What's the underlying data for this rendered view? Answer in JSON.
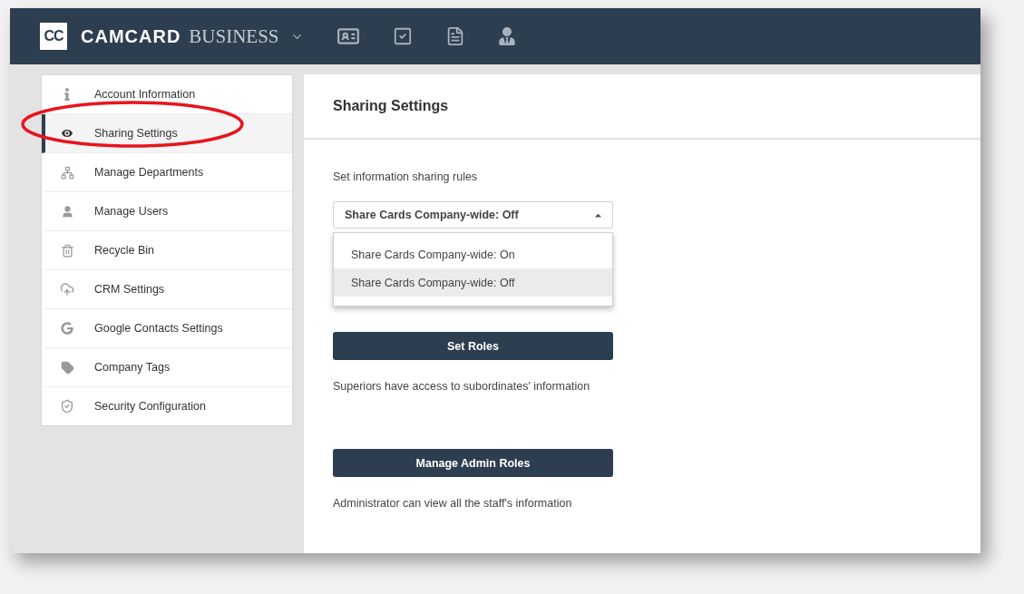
{
  "header": {
    "logo": "CC",
    "brand": "CAMCARD",
    "product": "BUSINESS"
  },
  "sidebar": {
    "items": [
      {
        "label": "Account Information",
        "selected": false
      },
      {
        "label": "Sharing Settings",
        "selected": true
      },
      {
        "label": "Manage Departments",
        "selected": false
      },
      {
        "label": "Manage Users",
        "selected": false
      },
      {
        "label": "Recycle Bin",
        "selected": false
      },
      {
        "label": "CRM Settings",
        "selected": false
      },
      {
        "label": "Google Contacts Settings",
        "selected": false
      },
      {
        "label": "Company Tags",
        "selected": false
      },
      {
        "label": "Security Configuration",
        "selected": false
      }
    ]
  },
  "main": {
    "title": "Sharing Settings",
    "rules_label": "Set information sharing rules",
    "select": {
      "value": "Share Cards Company-wide: Off",
      "expanded": true,
      "options": [
        {
          "label": "Share Cards Company-wide: On",
          "selected": false
        },
        {
          "label": "Share Cards Company-wide: Off",
          "selected": true
        }
      ]
    },
    "sections": [
      {
        "button": "Set Roles",
        "description": "Superiors have access to subordinates' information"
      },
      {
        "button": "Manage Admin Roles",
        "description": "Administrator can view all the staff's information"
      }
    ]
  }
}
